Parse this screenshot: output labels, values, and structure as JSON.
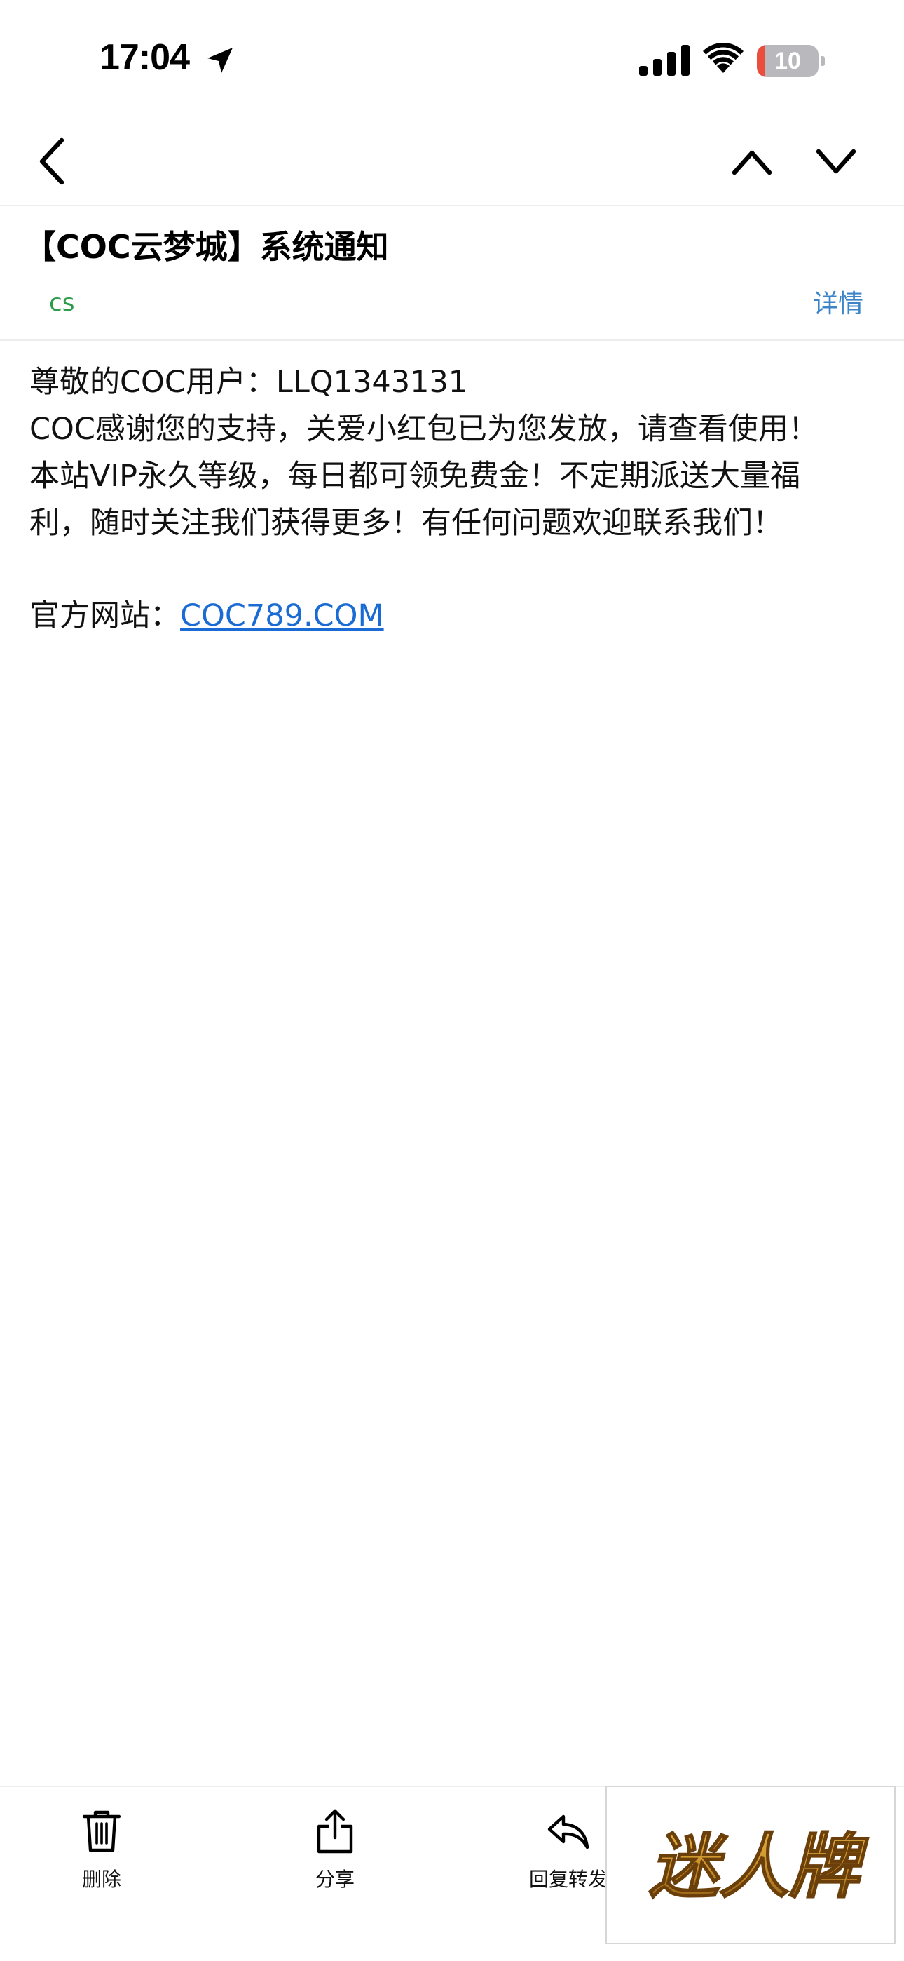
{
  "status_bar": {
    "time": "17:04",
    "battery_level": "10",
    "icons": [
      "location-arrow-icon",
      "cellular-signal-icon",
      "wifi-icon",
      "battery-icon"
    ]
  },
  "nav": {
    "icons": [
      "chevron-left-icon",
      "chevron-up-icon",
      "chevron-down-icon"
    ]
  },
  "mail": {
    "subject": "【COC云梦城】系统通知",
    "sender": "cs",
    "details_label": "详情",
    "body_lines": [
      "尊敬的COC用户：LLQ1343131",
      "COC感谢您的支持，关爱小红包已为您发放，请查看使用！",
      "本站VIP永久等级，每日都可领免费金！不定期派送大量福",
      "利，随时关注我们获得更多！有任何问题欢迎联系我们！"
    ],
    "website_label": "官方网站：",
    "website_link": "COC789.COM"
  },
  "toolbar": {
    "delete_label": "删除",
    "share_label": "分享",
    "reply_label": "回复转发"
  },
  "watermark": {
    "text": "迷人牌"
  },
  "colors": {
    "sender_green": "#2c9b4a",
    "link_blue": "#1a6cd4",
    "details_blue": "#3b84c9",
    "battery_red": "#eb4e3d",
    "watermark_gold": "#c8902a"
  }
}
